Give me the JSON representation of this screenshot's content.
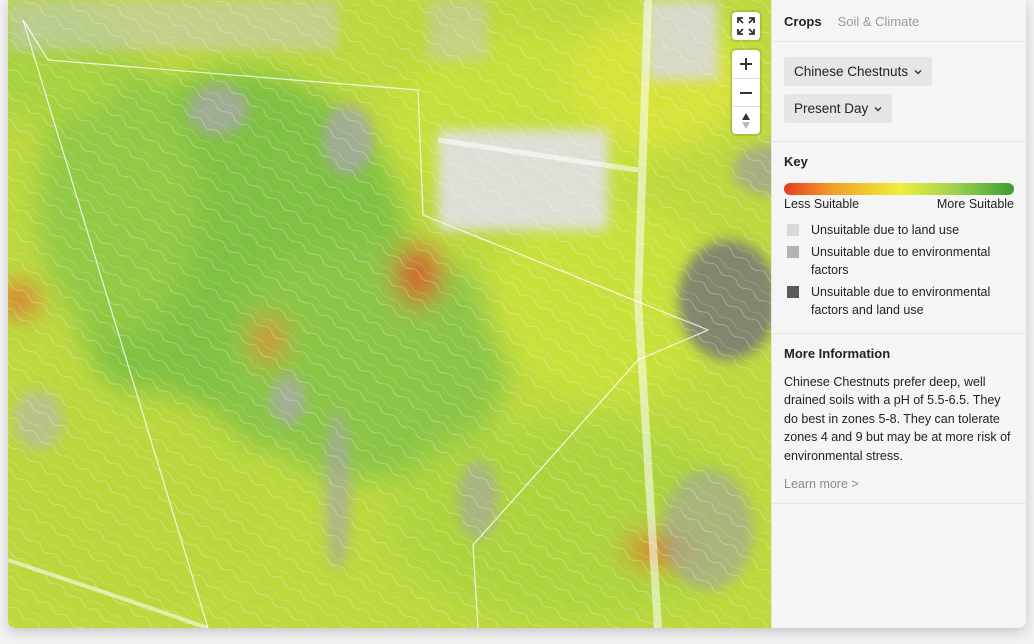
{
  "tabs": [
    {
      "label": "Crops",
      "active": true
    },
    {
      "label": "Soil & Climate",
      "active": false
    }
  ],
  "selectors": {
    "crop": "Chinese Chestnuts",
    "period": "Present Day"
  },
  "map_controls": [
    "fullscreen-icon",
    "zoom-in-icon",
    "zoom-out-icon",
    "compass-icon"
  ],
  "key": {
    "title": "Key",
    "less_label": "Less Suitable",
    "more_label": "More Suitable",
    "items": [
      {
        "label": "Unsuitable due to land use",
        "color": "#d9d9d9"
      },
      {
        "label": "Unsuitable due to environmental factors",
        "color": "#b3b3b3"
      },
      {
        "label": "Unsuitable due to environmental factors and land use",
        "color": "#5a5a5a"
      }
    ]
  },
  "more_info": {
    "title": "More Information",
    "text": "Chinese Chestnuts prefer deep, well drained soils with a pH of 5.5-6.5. They do best in zones 5-8. They can tolerate zones 4 and 9 but may be at more risk of environmental stress.",
    "link": "Learn more >"
  },
  "colors": {
    "suitability_low": "#e63b1f",
    "suitability_mid": "#f0ef3c",
    "suitability_high": "#3e9a2f"
  }
}
